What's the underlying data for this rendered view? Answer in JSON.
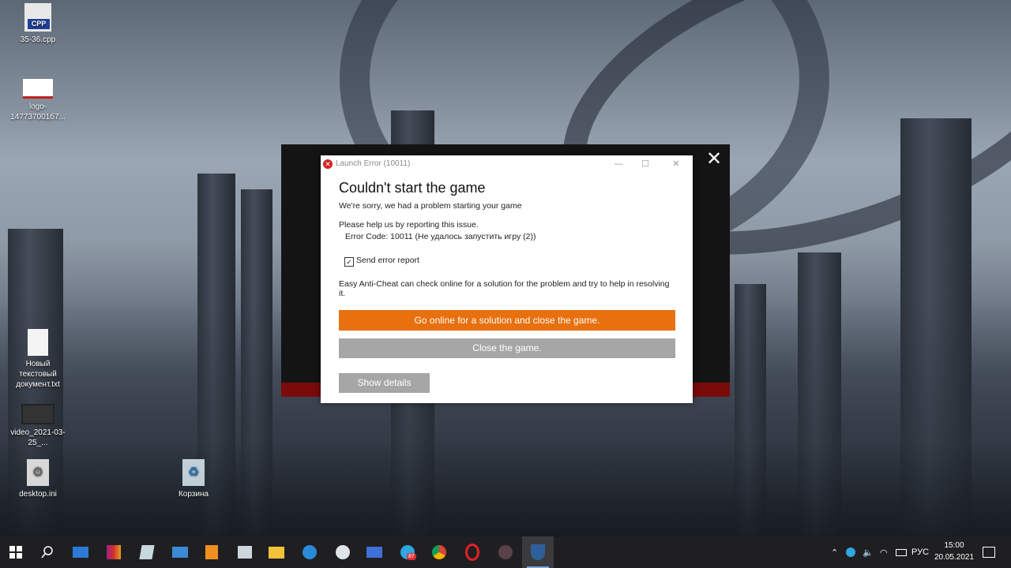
{
  "desktop": {
    "icons": [
      {
        "label": "35-36.cpp",
        "badge": "CPP"
      },
      {
        "label": "logo-147737001б7..."
      },
      {
        "label": "Новый текстовый документ.txt"
      },
      {
        "label": "video_2021-03-25_..."
      },
      {
        "label": "desktop.ini"
      },
      {
        "label": "Корзина"
      }
    ]
  },
  "launcher": {
    "close_glyph": "✕"
  },
  "dialog": {
    "window_title": "Launch Error (10011)",
    "error_glyph": "✕",
    "minimize_glyph": "—",
    "maximize_glyph": "☐",
    "close_glyph": "✕",
    "heading": "Couldn't start the game",
    "subtitle": "We're sorry, we had a problem starting your game",
    "help_text": "Please help us by reporting this issue.",
    "error_code": "Error Code: 10011 (Не удалось запустить игру (2))",
    "send_report_label": "Send error report",
    "send_report_checked": true,
    "eac_text": "Easy Anti-Cheat can check online for a solution for the problem and try to help in resolving it.",
    "online_button": "Go online for a solution and close the game.",
    "close_button": "Close the game.",
    "details_button": "Show details"
  },
  "taskbar": {
    "apps": [
      "start-icon",
      "search-icon",
      "mail-icon",
      "winrar-icon",
      "notes-icon",
      "remote-desktop-icon",
      "sublime-icon",
      "explorer-icon",
      "folder-icon",
      "settings-icon",
      "steam-icon",
      "display-icon",
      "telegram-icon",
      "chrome-icon",
      "opera-icon",
      "app-icon",
      "eac-icon"
    ],
    "telegram_badge": "87",
    "language": "РУС",
    "time": "15:00",
    "date": "20.05.2021"
  },
  "colors": {
    "accent_orange": "#e8700f",
    "button_gray": "#a6a6a6",
    "error_red": "#d42424"
  }
}
